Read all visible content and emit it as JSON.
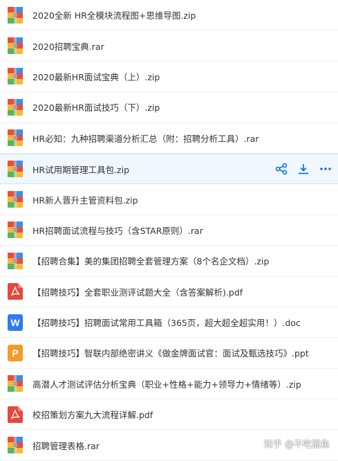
{
  "colors": {
    "accent": "#0a74e6",
    "hover_bg": "#f0f7ff",
    "text": "#333333",
    "pdf": "#e5483d",
    "doc": "#2f7bf0",
    "ppt": "#f39a2b"
  },
  "files": [
    {
      "name": "2020全新 HR全模块流程图+思维导图.zip",
      "type": "archive",
      "icon": "archive-icon"
    },
    {
      "name": "2020招聘宝典.rar",
      "type": "archive",
      "icon": "archive-icon"
    },
    {
      "name": "2020最新HR面试宝典（上）.zip",
      "type": "archive",
      "icon": "archive-icon"
    },
    {
      "name": "2020最新HR面试技巧（下）.zip",
      "type": "archive",
      "icon": "archive-icon"
    },
    {
      "name": "HR必知：九种招聘渠道分析汇总（附：招聘分析工具）.rar",
      "type": "archive",
      "icon": "archive-icon"
    },
    {
      "name": "HR试用期管理工具包.zip",
      "type": "archive",
      "icon": "archive-icon",
      "hovered": true
    },
    {
      "name": "HR新人晋升主管资料包.zip",
      "type": "archive",
      "icon": "archive-icon"
    },
    {
      "name": "HR招聘面试流程与技巧（含STAR原则）.rar",
      "type": "archive",
      "icon": "archive-icon"
    },
    {
      "name": "【招聘合集】美的集团招聘全套管理方案（8个名企文档）.zip",
      "type": "archive",
      "icon": "archive-icon"
    },
    {
      "name": "【招聘技巧】全套职业测评试题大全（含答案解析).pdf",
      "type": "pdf",
      "icon": "pdf-icon"
    },
    {
      "name": "【招聘技巧】招聘面试常用工具箱（365页，超大超全超实用！）.doc",
      "type": "doc",
      "icon": "word-icon"
    },
    {
      "name": "【招聘技巧】智联内部绝密讲义《做金牌面试官：面试及甄选技巧》.ppt",
      "type": "ppt",
      "icon": "ppt-icon"
    },
    {
      "name": "高潜人才测试评估分析宝典（职业+性格+能力+领导力+情绪等）.zip",
      "type": "archive",
      "icon": "archive-icon"
    },
    {
      "name": "校招策划方案九大流程详解.pdf",
      "type": "pdf",
      "icon": "pdf-icon"
    },
    {
      "name": "招聘管理表格.rar",
      "type": "archive",
      "icon": "archive-icon"
    }
  ],
  "row_actions": [
    {
      "name": "share",
      "icon": "share-icon"
    },
    {
      "name": "download",
      "icon": "download-icon"
    },
    {
      "name": "more",
      "icon": "more-icon"
    }
  ],
  "watermark": "知乎 @不吃猫鱼"
}
